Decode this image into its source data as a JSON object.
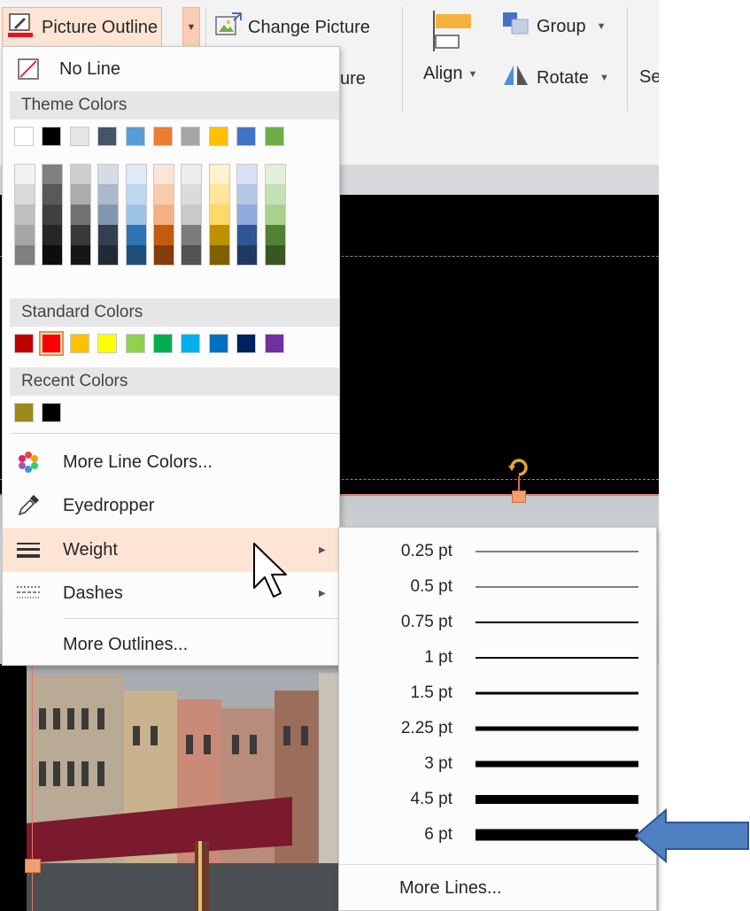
{
  "ribbon": {
    "picture_outline_label": "Picture Outline",
    "change_picture_label": "Change Picture",
    "reset_label_partial": "ure",
    "align_label": "Align",
    "group_label": "Group",
    "rotate_label": "Rotate",
    "selection_label_partial": "Se"
  },
  "menu": {
    "no_line_label": "No Line",
    "theme_colors_header": "Theme Colors",
    "standard_colors_header": "Standard Colors",
    "recent_colors_header": "Recent Colors",
    "more_line_colors_label": "More Line Colors...",
    "eyedropper_label": "Eyedropper",
    "weight_label": "Weight",
    "dashes_label": "Dashes",
    "more_outlines_label": "More Outlines...",
    "theme_colors": [
      "#ffffff",
      "#000000",
      "#e7e6e6",
      "#44546a",
      "#5b9bd5",
      "#ed7d31",
      "#a5a5a5",
      "#ffc000",
      "#4472c4",
      "#70ad47"
    ],
    "theme_shades": [
      [
        "#f2f2f2",
        "#d9d9d9",
        "#bfbfbf",
        "#a6a6a6",
        "#808080"
      ],
      [
        "#7f7f7f",
        "#595959",
        "#404040",
        "#262626",
        "#0d0d0d"
      ],
      [
        "#d0cece",
        "#afabab",
        "#767171",
        "#3b3838",
        "#171616"
      ],
      [
        "#d6dce5",
        "#adb9ca",
        "#8497b0",
        "#333f50",
        "#222a35"
      ],
      [
        "#deebf7",
        "#bdd7ee",
        "#9dc3e6",
        "#2e75b6",
        "#1f4e79"
      ],
      [
        "#fbe5d6",
        "#f8cbad",
        "#f4b183",
        "#c55a11",
        "#843c0c"
      ],
      [
        "#ededed",
        "#dbdbdb",
        "#c9c9c9",
        "#7b7b7b",
        "#525252"
      ],
      [
        "#fff2cc",
        "#ffe699",
        "#ffd966",
        "#bf9000",
        "#7f6000"
      ],
      [
        "#dae3f3",
        "#b4c7e7",
        "#8faadc",
        "#2f5597",
        "#203864"
      ],
      [
        "#e2f0d9",
        "#c5e0b4",
        "#a9d18e",
        "#548235",
        "#385723"
      ]
    ],
    "standard_colors": [
      "#c00000",
      "#ff0000",
      "#ffc000",
      "#ffff00",
      "#92d050",
      "#00b050",
      "#00b0f0",
      "#0070c0",
      "#002060",
      "#7030a0"
    ],
    "recent_colors": [
      "#9c8a1c",
      "#000000"
    ]
  },
  "weight_menu": {
    "items": [
      {
        "label": "0.25 pt",
        "pt": 0.25
      },
      {
        "label": "0.5 pt",
        "pt": 0.5
      },
      {
        "label": "0.75 pt",
        "pt": 0.75
      },
      {
        "label": "1 pt",
        "pt": 1
      },
      {
        "label": "1.5 pt",
        "pt": 1.5
      },
      {
        "label": "2.25 pt",
        "pt": 2.25
      },
      {
        "label": "3 pt",
        "pt": 3
      },
      {
        "label": "4.5 pt",
        "pt": 4.5
      },
      {
        "label": "6 pt",
        "pt": 6
      }
    ],
    "more_lines_label": "More Lines..."
  },
  "colors": {
    "accent_highlight": "#fde4d4",
    "outline_red": "#e81123",
    "callout_arrow": "#4472c4"
  }
}
